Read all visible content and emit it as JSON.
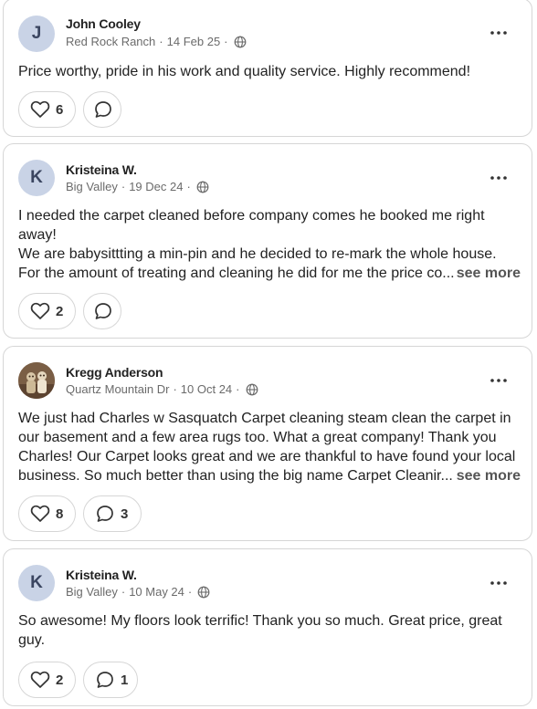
{
  "posts": [
    {
      "avatar_letter": "J",
      "author": "John Cooley",
      "location": "Red Rock Ranch",
      "date": "14 Feb 25",
      "body_lines": [
        "Price worthy, pride in his work and quality service. Highly recommend!"
      ],
      "likes": "6",
      "comments": ""
    },
    {
      "avatar_letter": "K",
      "author": "Kristeina W.",
      "location": "Big Valley",
      "date": "19 Dec 24",
      "body_lines": [
        "I needed the carpet cleaned before company comes he booked me right",
        "away!",
        "We are babysittting a min-pin and he decided to re-mark the whole house.",
        "For the amount of treating and cleaning he did for me the price co..."
      ],
      "see_more": "see more",
      "likes": "2",
      "comments": ""
    },
    {
      "avatar_letter": "",
      "author": "Kregg Anderson",
      "location": "Quartz Mountain Dr",
      "date": "10 Oct 24",
      "body_lines": [
        "We just had Charles w Sasquatch Carpet cleaning steam clean the carpet in",
        "our basement and a few area rugs too. What a great company! Thank you",
        "Charles!  Our Carpet looks great and we are thankful to have found your local",
        "business.  So much better than using the big name Carpet Cleanir..."
      ],
      "see_more": "see more",
      "likes": "8",
      "comments": "3"
    },
    {
      "avatar_letter": "K",
      "author": "Kristeina W.",
      "location": "Big Valley",
      "date": "10 May 24",
      "body_lines": [
        "So awesome! My floors look terrific! Thank you so much. Great price, great",
        "guy."
      ],
      "likes": "2",
      "comments": "1"
    }
  ],
  "separator": "·",
  "icons": {
    "visibility": "globe-icon",
    "like": "heart-icon",
    "comment": "comment-bubble-icon",
    "menu": "more-horizontal-icon"
  }
}
